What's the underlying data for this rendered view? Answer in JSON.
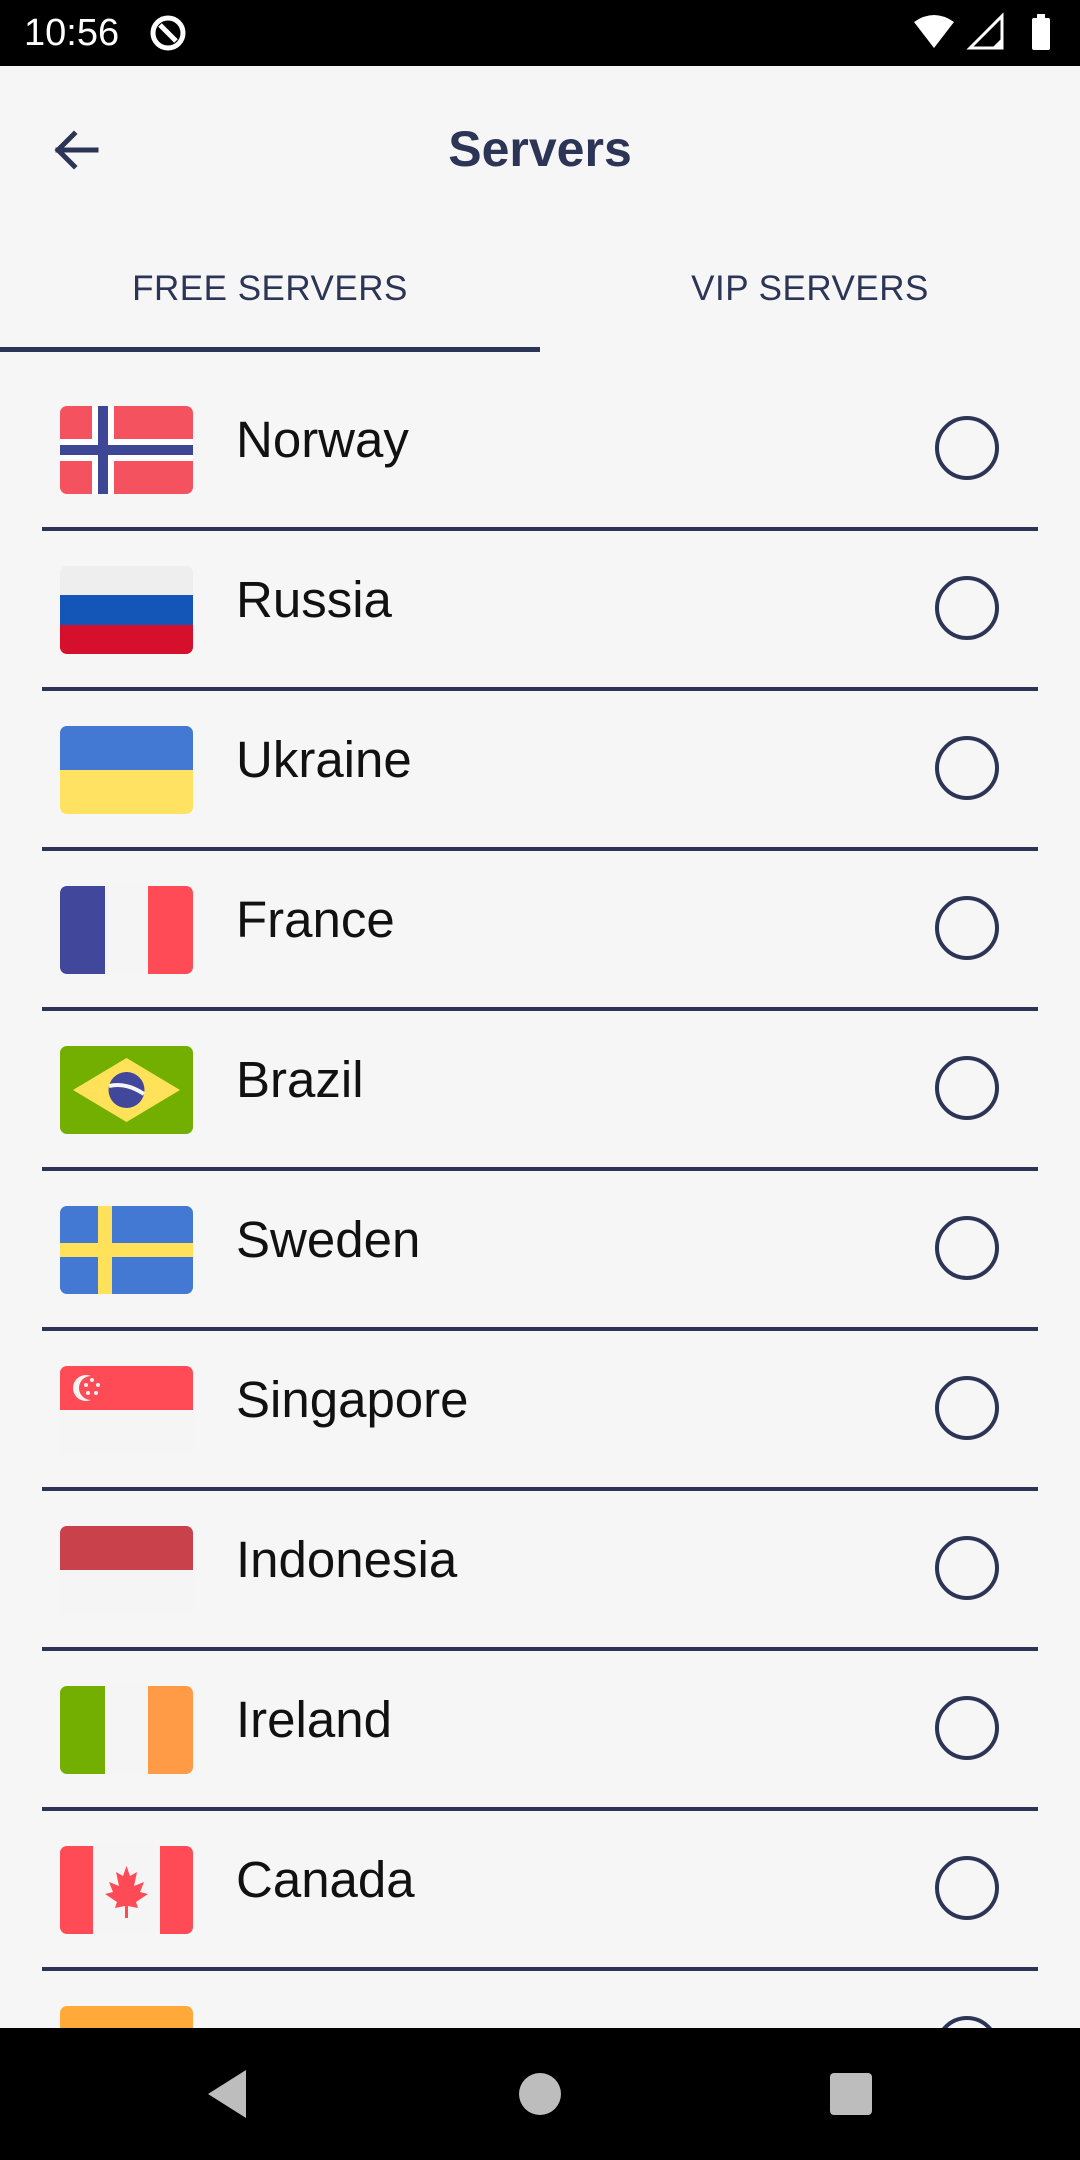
{
  "status_bar": {
    "time": "10:56"
  },
  "header": {
    "title": "Servers"
  },
  "tabs": [
    {
      "label": "FREE SERVERS"
    },
    {
      "label": "VIP SERVERS"
    }
  ],
  "servers": [
    {
      "name": "Norway",
      "flag": "norway-flag"
    },
    {
      "name": "Russia",
      "flag": "russia-flag"
    },
    {
      "name": "Ukraine",
      "flag": "ukraine-flag"
    },
    {
      "name": "France",
      "flag": "france-flag"
    },
    {
      "name": "Brazil",
      "flag": "brazil-flag"
    },
    {
      "name": "Sweden",
      "flag": "sweden-flag"
    },
    {
      "name": "Singapore",
      "flag": "singapore-flag"
    },
    {
      "name": "Indonesia",
      "flag": "indonesia-flag"
    },
    {
      "name": "Ireland",
      "flag": "ireland-flag"
    },
    {
      "name": "Canada",
      "flag": "canada-flag"
    }
  ],
  "colors": {
    "primary": "#2c3556",
    "background": "#f6f6f7",
    "text": "#111111"
  }
}
